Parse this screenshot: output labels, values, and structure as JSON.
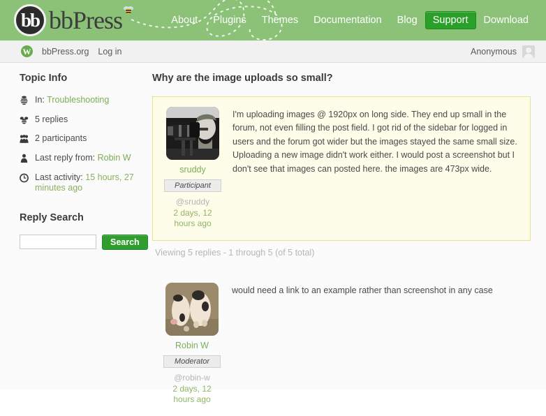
{
  "header": {
    "logo_text": "bbPress",
    "logo_mark": "bb",
    "bee_icon": "bee-icon",
    "nav": [
      {
        "label": "About",
        "active": false
      },
      {
        "label": "Plugins",
        "active": false
      },
      {
        "label": "Themes",
        "active": false
      },
      {
        "label": "Documentation",
        "active": false
      },
      {
        "label": "Blog",
        "active": false
      },
      {
        "label": "Support",
        "active": true
      },
      {
        "label": "Download",
        "active": false
      }
    ],
    "colors": {
      "header_bg": "#8cc278",
      "active_nav_bg": "#2aa02a",
      "nav_text": "#ffffff"
    }
  },
  "admin_bar": {
    "site_name": "bbPress.org",
    "login_label": "Log in",
    "user_label": "Anonymous",
    "wp_mark": "W"
  },
  "sidebar": {
    "topic_info": {
      "title": "Topic Info",
      "items": [
        {
          "icon": "forum-icon",
          "prefix": "In:",
          "value": "Troubleshooting",
          "link": true
        },
        {
          "icon": "reply-icon",
          "prefix": "5 replies",
          "value": "",
          "link": false
        },
        {
          "icon": "participants-icon",
          "prefix": "2 participants",
          "value": "",
          "link": false
        },
        {
          "icon": "user-icon",
          "prefix": "Last reply from:",
          "value": "Robin W",
          "link": true
        },
        {
          "icon": "clock-icon",
          "prefix": "Last activity:",
          "value": "15 hours, 27 minutes ago",
          "link": false
        }
      ]
    },
    "reply_search": {
      "title": "Reply Search",
      "input_value": "",
      "input_placeholder": "",
      "button_label": "Search"
    }
  },
  "main": {
    "topic_title": "Why are the image uploads so small?",
    "pagination_note": "Viewing 5 replies - 1 through 5 (of 5 total)",
    "replies": [
      {
        "highlight": true,
        "avatar": "photographer-avatar",
        "author": "sruddy",
        "role": "Participant",
        "handle": "@sruddy",
        "date": "2 days, 12 hours ago",
        "body": "I'm uploading images @ 1920px on long side. They end up small in the forum, not even filling the post field. I got rid of the sidebar for logged in users and the forum got wider but the images stayed the same small size. Uploading a new image didn't work either. I would post a screenshot but I don't see that images can posted here. the images are 473px wide."
      },
      {
        "highlight": false,
        "avatar": "piglets-avatar",
        "author": "Robin W",
        "role": "Moderator",
        "handle": "@robin-w",
        "date": "2 days, 12 hours ago",
        "body": "would need a link to an example rather than screenshot in any case"
      }
    ]
  },
  "colors": {
    "link_green": "#7aad56",
    "highlight_bg": "#fdfdea",
    "highlight_border": "#e5e58a",
    "page_bg": "#fbfbfb",
    "search_button": "#2f9e2f"
  }
}
